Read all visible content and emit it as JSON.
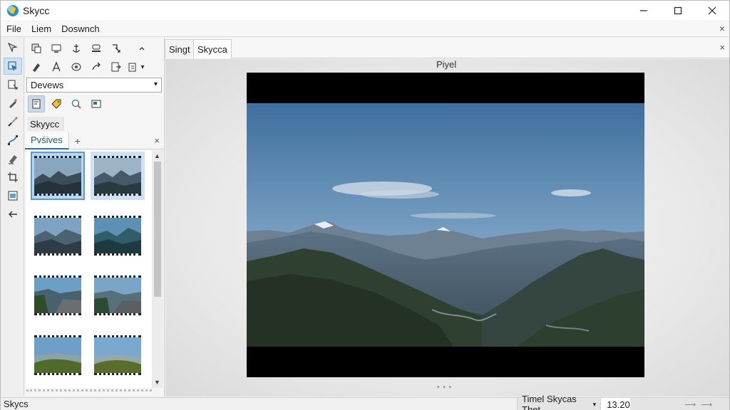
{
  "window": {
    "title": "Skycc",
    "controls": {
      "minimize": "—",
      "maximize": "☐",
      "close": "✕"
    }
  },
  "menu": {
    "items": [
      "File",
      "Liem",
      "Doswnch"
    ],
    "close": "×"
  },
  "left_toolbar": {
    "tools": [
      "select-arrow",
      "direct-select",
      "text-insert",
      "pen",
      "brush",
      "path",
      "eraser",
      "crop",
      "layers",
      "back-arrow"
    ],
    "active_index": 1
  },
  "side_panel": {
    "tool_rows": {
      "row1": [
        "copy",
        "frame",
        "anchor",
        "stamp",
        "transform"
      ],
      "row2": [
        "pen",
        "type",
        "lens",
        "share",
        "export",
        "duplicate"
      ],
      "row3": [
        "panel",
        "tag",
        "search-globe",
        "window"
      ]
    },
    "dropdown": {
      "value": "Devews"
    },
    "section_label": "Skyycc",
    "tabs": {
      "active": "Pvśives",
      "add": "+",
      "close": "×"
    },
    "thumbnails": [
      {
        "scene": "mountains-dusk",
        "selected": true
      },
      {
        "scene": "mountains-dusk",
        "selected": true
      },
      {
        "scene": "mountains-blue",
        "selected": false
      },
      {
        "scene": "mountains-teal",
        "selected": false
      },
      {
        "scene": "road-forest",
        "selected": false
      },
      {
        "scene": "road-bay",
        "selected": false
      },
      {
        "scene": "meadow-sky",
        "selected": false
      },
      {
        "scene": "meadow-hill",
        "selected": false
      }
    ],
    "scroll": {
      "up": "▲",
      "down": "▼"
    }
  },
  "document": {
    "tabs": [
      {
        "label": "Singt",
        "active": false
      },
      {
        "label": "Skycca",
        "active": true
      }
    ],
    "close": "×",
    "canvas_title": "Piyel",
    "canvas_dots": "• • •"
  },
  "status": {
    "left": "Skycs",
    "select_label": "Timel Skycas Thet",
    "select_arrow": "▾",
    "zoom": "13.20",
    "slider": "⟶ ⟶"
  },
  "colors": {
    "selection": "#5a9bd4",
    "accent": "#2b6ea0",
    "sky": "#5e87b2",
    "mountain": "#2c3a44"
  }
}
